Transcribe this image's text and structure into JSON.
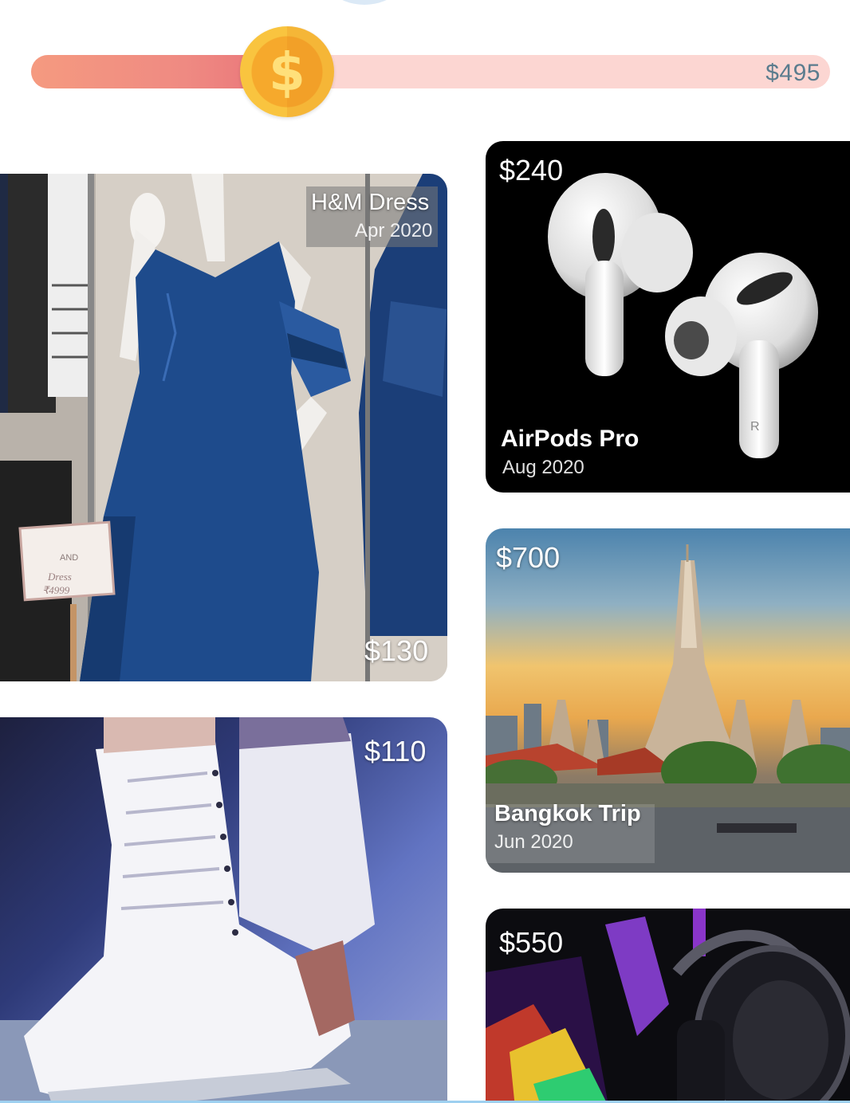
{
  "slider": {
    "value_label": "$495",
    "fill_fraction": 0.32,
    "thumb_icon": "dollar-coin-icon",
    "thumb_glyph": "$",
    "colors": {
      "track": "#fcd6d2",
      "fill": "#ef8a82",
      "thumb": "#f9c43f"
    }
  },
  "cards": {
    "dress": {
      "price": "$130",
      "title": "H&M Dress",
      "date": "Apr 2020"
    },
    "airpods": {
      "price": "$240",
      "title": "AirPods Pro",
      "date": "Aug 2020"
    },
    "bangkok": {
      "price": "$700",
      "title": "Bangkok Trip",
      "date": "Jun 2020"
    },
    "skates": {
      "price": "$110"
    },
    "gaming": {
      "price": "$550"
    }
  },
  "dress_scene": {
    "sign_top": "AND",
    "sign_item": "Dress",
    "sign_price": "₹4999"
  },
  "airpods_scene": {
    "earbud_mark": "R"
  }
}
